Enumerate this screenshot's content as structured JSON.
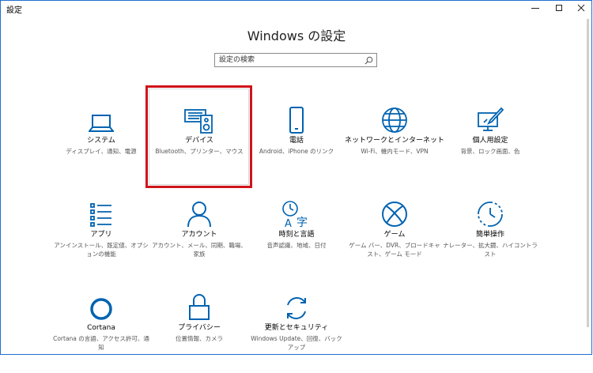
{
  "window": {
    "title": "設定",
    "minimize_label": "minimize",
    "maximize_label": "maximize",
    "close_label": "close"
  },
  "page_title": "Windows の設定",
  "search": {
    "placeholder": "設定の検索"
  },
  "accent_color": "#0063b1",
  "highlight_color": "#d0131b",
  "tiles": [
    {
      "label": "システム",
      "desc": "ディスプレイ、通知、電源",
      "icon": "laptop-icon"
    },
    {
      "label": "デバイス",
      "desc": "Bluetooth、プリンター、マウス",
      "icon": "devices-icon"
    },
    {
      "label": "電話",
      "desc": "Android、iPhone のリンク",
      "icon": "phone-icon"
    },
    {
      "label": "ネットワークとインターネット",
      "desc": "Wi-Fi、機内モード、VPN",
      "icon": "globe-icon"
    },
    {
      "label": "個人用設定",
      "desc": "背景、ロック画面、色",
      "icon": "personalization-icon"
    },
    {
      "label": "アプリ",
      "desc": "アンインストール、既定値、オプションの機能",
      "icon": "apps-list-icon"
    },
    {
      "label": "アカウント",
      "desc": "アカウント、メール、同期、職場、家族",
      "icon": "person-icon"
    },
    {
      "label": "時刻と言語",
      "desc": "音声認識、地域、日付",
      "icon": "time-language-icon"
    },
    {
      "label": "ゲーム",
      "desc": "ゲーム バー、DVR、ブロードキャスト、ゲーム モード",
      "icon": "xbox-icon"
    },
    {
      "label": "簡単操作",
      "desc": "ナレーター、拡大鏡、ハイコントラスト",
      "icon": "ease-of-access-icon"
    },
    {
      "label": "Cortana",
      "desc": "Cortana の言語、アクセス許可、通知",
      "icon": "cortana-icon"
    },
    {
      "label": "プライバシー",
      "desc": "位置情報、カメラ",
      "icon": "lock-icon"
    },
    {
      "label": "更新とセキュリティ",
      "desc": "Windows Update、回復、バックアップ",
      "icon": "update-icon"
    }
  ]
}
